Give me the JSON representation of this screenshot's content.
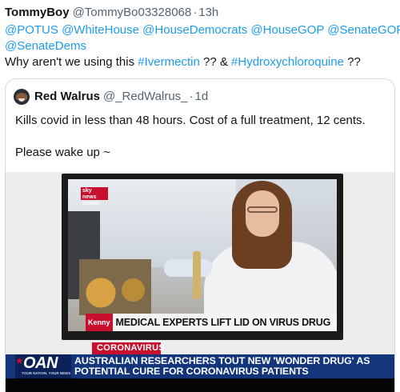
{
  "tweet": {
    "display_name": "TommyBoy",
    "handle": "@TommyBo03328068",
    "separator": "·",
    "time": "13h",
    "mentions_line1": "@POTUS @WhiteHouse @HouseDemocrats @HouseGOP @SenateGOP",
    "mentions_line2": "@SenateDems",
    "text_prefix": "Why aren't we using this ",
    "hashtag1": "#Ivermectin",
    "text_middle": " ?? & ",
    "hashtag2": "#Hydroxychloroquine",
    "text_suffix": " ??"
  },
  "quote": {
    "display_name": "Red Walrus",
    "handle": "@_RedWalrus_",
    "separator": "·",
    "time": "1d",
    "text_line1": "Kills covid in less than 48 hours. Cost of a full treatment, 12 cents.",
    "text_line2": "Please wake up ~"
  },
  "media": {
    "sky_logo": "sky news",
    "sky_sub": "CORAAU",
    "kenny_tag": "Kenny",
    "lower_third": "MEDICAL EXPERTS LIFT LID ON VIRUS DRUG",
    "oan_topic": "CORONAVIRUS",
    "oan_logo": "OAN",
    "oan_tagline": "YOUR NATION. YOUR NEWS",
    "oan_headline_line1": "AUSTRALIAN RESEARCHERS TOUT NEW 'WONDER DRUG' AS",
    "oan_headline_line2": "POTENTIAL CURE FOR CORONAVIRUS PATIENTS"
  },
  "colors": {
    "link": "#1d9bf0",
    "text": "#0f1419",
    "muted": "#536471",
    "oan_blue": "#12357c",
    "news_red": "#c8102e"
  }
}
